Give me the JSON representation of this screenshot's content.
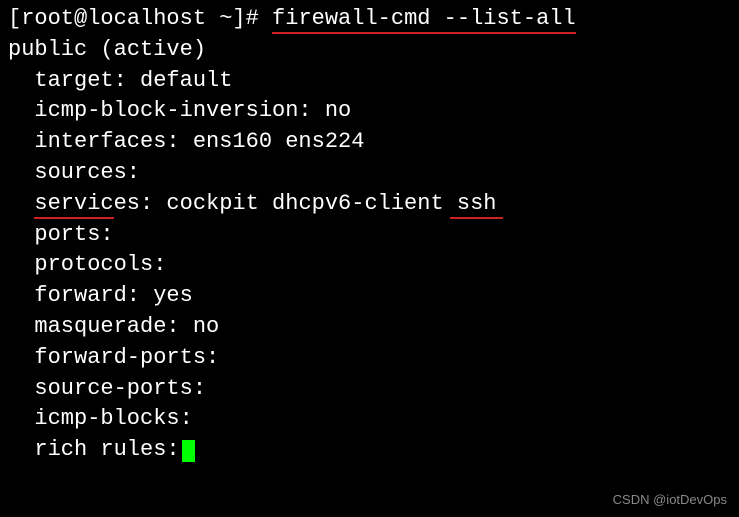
{
  "prompt": {
    "user_host": "[root@localhost ~]# ",
    "command": "firewall-cmd --list-all"
  },
  "output": {
    "zone_line": "public (active)",
    "target": "target: default",
    "icmp_block_inversion": "icmp-block-inversion: no",
    "interfaces": "interfaces: ens160 ens224",
    "sources": "sources:",
    "services_label": "services:",
    "services_value_pre": " cockpit dhcpv6-client ",
    "services_ssh": "ssh",
    "ports": "ports:",
    "protocols": "protocols:",
    "forward": "forward: yes",
    "masquerade": "masquerade: no",
    "forward_ports": "forward-ports:",
    "source_ports": "source-ports:",
    "icmp_blocks": "icmp-blocks:",
    "rich_rules": "rich rules:"
  },
  "watermark": "CSDN @iotDevOps"
}
